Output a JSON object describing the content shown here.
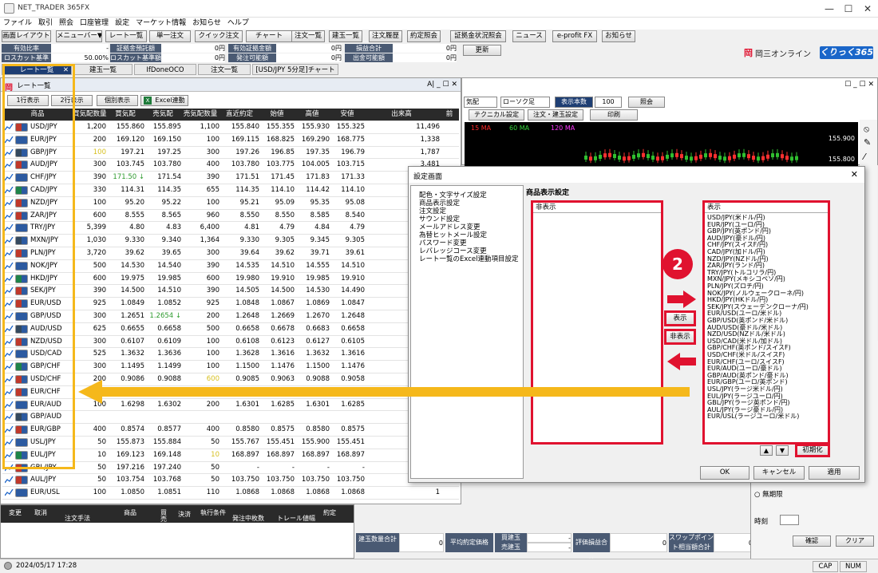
{
  "window": {
    "title": "NET_TRADER 365FX",
    "minimize": "—",
    "maximize": "☐",
    "close": "✕"
  },
  "menu": [
    "ファイル",
    "取引",
    "照会",
    "口座管理",
    "設定",
    "マーケット情報",
    "お知らせ",
    "ヘルプ"
  ],
  "toolbar": [
    "画面レイアウト▼",
    "メニューバー▼",
    "レート一覧",
    "単一注文",
    "クイック注文",
    "チャート",
    "注文一覧",
    "建玉一覧",
    "注文履歴",
    "約定照会",
    "証拠金状況照会",
    "ニュース",
    "e-profit FX",
    "お知らせ"
  ],
  "info": {
    "labels": [
      "有効比率",
      "ロスカット基準",
      "証拠金預託額",
      "ロスカット基準額",
      "有効証拠金額",
      "発注可能額",
      "損益合計",
      "出金可能額"
    ],
    "values": [
      "-",
      "50.00%",
      "0円",
      "0円",
      "0円",
      "0円",
      "0円",
      "0円"
    ],
    "update": "更新"
  },
  "brand": {
    "name": "岡三オンライン",
    "product": "くりっく365",
    "logo": "岡"
  },
  "tabs": [
    "レート一覧",
    "建玉一覧",
    "IfDoneOCO",
    "注文一覧",
    "[USD/JPY 5分足]チャート"
  ],
  "tab_close": "✕",
  "rate_panel": {
    "title": "レート一覧",
    "title_ctrl": "A| _ ☐ ✕",
    "buttons": [
      "1行表示",
      "2行表示",
      "個別表示",
      "Excel連動"
    ],
    "excel_icon": "X",
    "headers": [
      "商品",
      "買気配数量",
      "買気配",
      "売気配",
      "売気配数量",
      "直近約定",
      "始値",
      "高値",
      "安値",
      "出来高",
      "前"
    ],
    "rows": [
      [
        "USD/JPY",
        "1,200",
        "155.860",
        "155.895",
        "1,100",
        "155.840",
        "155.355",
        "155.930",
        "155.325",
        "11,496"
      ],
      [
        "EUR/JPY",
        "200",
        "169.120",
        "169.150",
        "100",
        "169.115",
        "168.825",
        "169.290",
        "168.775",
        "1,338"
      ],
      [
        "GBP/JPY",
        "100",
        "197.21",
        "197.25",
        "300",
        "197.26",
        "196.85",
        "197.35",
        "196.79",
        "1,787"
      ],
      [
        "AUD/JPY",
        "300",
        "103.745",
        "103.780",
        "400",
        "103.780",
        "103.775",
        "104.005",
        "103.715",
        "3,481"
      ],
      [
        "CHF/JPY",
        "390",
        "171.50 ↓",
        "171.54",
        "390",
        "171.51",
        "171.45",
        "171.83",
        "171.33",
        "3,700"
      ],
      [
        "CAD/JPY",
        "330",
        "114.31",
        "114.35",
        "655",
        "114.35",
        "114.10",
        "114.42",
        "114.10",
        "280"
      ],
      [
        "NZD/JPY",
        "100",
        "95.20",
        "95.22",
        "100",
        "95.21",
        "95.09",
        "95.35",
        "95.08",
        "80"
      ],
      [
        "ZAR/JPY",
        "600",
        "8.555",
        "8.565",
        "960",
        "8.550",
        "8.550",
        "8.585",
        "8.540",
        "2,316"
      ],
      [
        "TRY/JPY",
        "5,399",
        "4.80",
        "4.83",
        "6,400",
        "4.81",
        "4.79",
        "4.84",
        "4.79",
        "1,150"
      ],
      [
        "MXN/JPY",
        "1,030",
        "9.330",
        "9.340",
        "1,364",
        "9.330",
        "9.305",
        "9.345",
        "9.305",
        "1,000"
      ],
      [
        "PLN/JPY",
        "3,720",
        "39.62",
        "39.65",
        "300",
        "39.64",
        "39.62",
        "39.71",
        "39.61",
        "1"
      ],
      [
        "NOK/JPY",
        "500",
        "14.530",
        "14.540",
        "390",
        "14.535",
        "14.510",
        "14.555",
        "14.510",
        "1"
      ],
      [
        "HKD/JPY",
        "600",
        "19.975",
        "19.985",
        "600",
        "19.980",
        "19.910",
        "19.985",
        "19.910",
        "1"
      ],
      [
        "SEK/JPY",
        "390",
        "14.500",
        "14.510",
        "390",
        "14.505",
        "14.500",
        "14.530",
        "14.490",
        "1"
      ],
      [
        "EUR/USD",
        "925",
        "1.0849",
        "1.0852",
        "925",
        "1.0848",
        "1.0867",
        "1.0869",
        "1.0847",
        "1"
      ],
      [
        "GBP/USD",
        "300",
        "1.2651",
        "1.2654 ↓",
        "200",
        "1.2648",
        "1.2669",
        "1.2670",
        "1.2648",
        "1"
      ],
      [
        "AUD/USD",
        "625",
        "0.6655",
        "0.6658",
        "500",
        "0.6658",
        "0.6678",
        "0.6683",
        "0.6658",
        "1"
      ],
      [
        "NZD/USD",
        "300",
        "0.6107",
        "0.6109",
        "100",
        "0.6108",
        "0.6123",
        "0.6127",
        "0.6105",
        "1"
      ],
      [
        "USD/CAD",
        "525",
        "1.3632",
        "1.3636",
        "100",
        "1.3628",
        "1.3616",
        "1.3632",
        "1.3616",
        "1"
      ],
      [
        "GBP/CHF",
        "300",
        "1.1495",
        "1.1499",
        "100",
        "1.1500",
        "1.1476",
        "1.1500",
        "1.1476",
        "1"
      ],
      [
        "USD/CHF",
        "200",
        "0.9086",
        "0.9088",
        "600",
        "0.9085",
        "0.9063",
        "0.9088",
        "0.9058",
        "1"
      ],
      [
        "EUR/CHF",
        "100",
        "0.9859",
        "0.9861",
        "100",
        "0.9849",
        "0.9846",
        "0.9853",
        "0.9846",
        "1"
      ],
      [
        "EUR/AUD",
        "100",
        "1.6298",
        "1.6302",
        "200",
        "1.6301",
        "1.6285",
        "1.6301",
        "1.6285",
        "1"
      ],
      [
        "GBP/AUD",
        "",
        "",
        "",
        "",
        "",
        "",
        "",
        "",
        ""
      ],
      [
        "EUR/GBP",
        "400",
        "0.8574",
        "0.8577",
        "400",
        "0.8580",
        "0.8575",
        "0.8580",
        "0.8575",
        "1"
      ],
      [
        "USL/JPY",
        "50",
        "155.873",
        "155.884",
        "50",
        "155.767",
        "155.451",
        "155.900",
        "155.451",
        "1"
      ],
      [
        "EUL/JPY",
        "10",
        "169.123",
        "169.148",
        "10",
        "168.897",
        "168.897",
        "168.897",
        "168.897",
        "1"
      ],
      [
        "GBL/JPY",
        "50",
        "197.216",
        "197.240",
        "50",
        "-",
        "-",
        "-",
        "-",
        "1"
      ],
      [
        "AUL/JPY",
        "50",
        "103.754",
        "103.768",
        "50",
        "103.750",
        "103.750",
        "103.750",
        "103.750",
        "1"
      ],
      [
        "EUR/USL",
        "100",
        "1.0850",
        "1.0851",
        "110",
        "1.0868",
        "1.0868",
        "1.0868",
        "1.0868",
        "1"
      ]
    ]
  },
  "chart_panel": {
    "selects": [
      "気配",
      "ローソク足"
    ],
    "count_label": "表示本数",
    "count_value": "100",
    "query": "照会",
    "tech": "テクニカル設定",
    "order": "注文・建玉設定",
    "print": "印刷",
    "ma": [
      "15 MA",
      "60 MA",
      "120 MA"
    ],
    "ma_colors": [
      "#ff2a2a",
      "#36d43c",
      "#ff37ff"
    ],
    "prices": [
      "155.900",
      "155.800"
    ],
    "chart_ctrl": "☐ _ ☐ ✕",
    "tools": [
      "⦸",
      "✎",
      "⁄"
    ]
  },
  "dialog": {
    "title": "設定画面",
    "close": "✕",
    "tree": [
      "配色・文字サイズ設定",
      "商品表示設定",
      "注文設定",
      "サウンド設定",
      "メールアドレス変更",
      "為替ヒットメール設定",
      "パスワード変更",
      "レバレッジコース変更",
      "レート一覧のExcel連動項目設定"
    ],
    "section_title": "商品表示設定",
    "hidden_header": "非表示",
    "shown_header": "表示",
    "shown_items": [
      "USD/JPY(米ドル/円)",
      "EUR/JPY(ユーロ/円)",
      "GBP/JPY(英ポンド/円)",
      "AUD/JPY(豪ドル/円)",
      "CHF/JPY(スイスF/円)",
      "CAD/JPY(加ドル/円)",
      "NZD/JPY(NZドル/円)",
      "ZAR/JPY(ランド/円)",
      "TRY/JPY(トルコリラ/円)",
      "MXN/JPY(メキシコペソ/円)",
      "PLN/JPY(ズロチ/円)",
      "NOK/JPY(ノルウェークローネ/円)",
      "HKD/JPY(HKドル/円)",
      "SEK/JPY(スウェーデンクローナ/円)",
      "EUR/USD(ユーロ/米ドル)",
      "GBP/USD(英ポンド/米ドル)",
      "AUD/USD(豪ドル/米ドル)",
      "NZD/USD(NZドル/米ドル)",
      "USD/CAD(米ドル/加ドル)",
      "GBP/CHF(英ポンド/スイスF)",
      "USD/CHF(米ドル/スイスF)",
      "EUR/CHF(ユーロ/スイスF)",
      "EUR/AUD(ユーロ/豪ドル)",
      "GBP/AUD(英ポンド/豪ドル)",
      "EUR/GBP(ユーロ/英ポンド)",
      "USL/JPY(ラージ米ドル/円)",
      "EUL/JPY(ラージユーロ/円)",
      "GBL/JPY(ラージ英ポンド/円)",
      "AUL/JPY(ラージ豪ドル/円)",
      "EUR/USL(ラージユーロ/米ドル)"
    ],
    "badge": "2",
    "show_btn": "表示",
    "hide_btn": "非表示",
    "up": "▲",
    "down": "▼",
    "reset": "初期化",
    "ok": "OK",
    "cancel": "キャンセル",
    "apply": "適用"
  },
  "order_panel": {
    "headers": [
      "変更",
      "取消",
      "注文手法",
      "商品",
      "買",
      "売",
      "決済",
      "執行条件",
      "発注中枚数",
      "トレール値幅",
      "約定"
    ],
    "values": [
      "変更",
      "取消"
    ]
  },
  "stats": {
    "labels": [
      "建玉数量合計",
      "平均約定価格",
      "買建玉",
      "売建玉",
      "評価損益合計",
      "スワップポイント相当額合計"
    ],
    "values": [
      "0",
      "-",
      "-",
      "0",
      "0"
    ]
  },
  "right_lower": {
    "no_expiry": "無期限",
    "time_label": "時刻",
    "confirm": "確認",
    "clear": "クリア"
  },
  "status": {
    "datetime": "2024/05/17 17:28",
    "caps": "CAP",
    "num": "NUM"
  },
  "colors": {
    "highlight": "#f5b81b",
    "red": "#e0122f",
    "header": "#2a2a2a",
    "label": "#4a5a73",
    "active_tab": "#1e3e73"
  }
}
